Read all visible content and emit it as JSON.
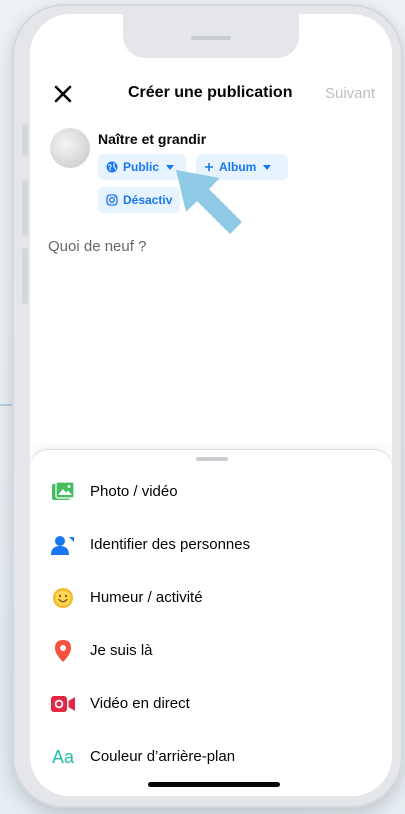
{
  "header": {
    "close_icon": "close-icon",
    "title": "Créer une publication",
    "next_label": "Suivant"
  },
  "composer": {
    "username": "Naître et grandir",
    "audience_label": "Public",
    "album_label": "Album",
    "instagram_label": "Désactiv",
    "prompt": "Quoi de neuf ?"
  },
  "actions": [
    {
      "label": "Photo / vidéo",
      "icon": "photo-icon",
      "color": "#45bd62"
    },
    {
      "label": "Identifier des personnes",
      "icon": "tag-people-icon",
      "color": "#1877f2"
    },
    {
      "label": "Humeur / activité",
      "icon": "feeling-icon",
      "color": "#f7b928"
    },
    {
      "label": "Je suis là",
      "icon": "location-pin-icon",
      "color": "#f5533d"
    },
    {
      "label": "Vidéo en direct",
      "icon": "live-video-icon",
      "color": "#e42645"
    },
    {
      "label": "Couleur d’arrière-plan",
      "icon": "background-color-icon",
      "icon_text": "Aa",
      "color": "#20c2a6"
    }
  ],
  "colors": {
    "accent": "#1877f2",
    "chip_bg": "#e7f3ff",
    "pointer_arrow": "#8ecae6"
  }
}
